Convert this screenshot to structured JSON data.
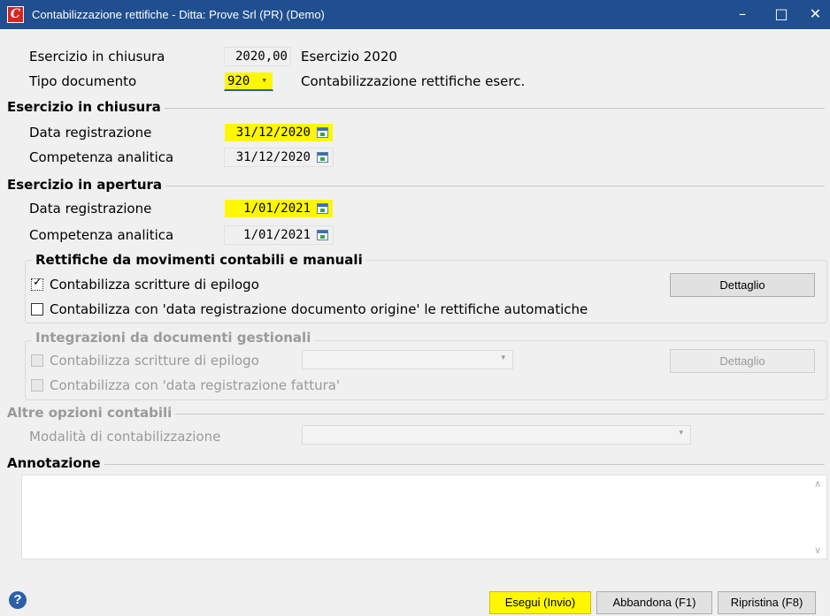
{
  "window": {
    "title": "Contabilizzazione rettifiche - Ditta: Prove Srl (PR)  (Demo)",
    "minimize": "–",
    "maximize": "□",
    "close": "✕"
  },
  "header": {
    "esercizio_label": "Esercizio in chiusura",
    "esercizio_value": "2020,00",
    "esercizio_desc": "Esercizio 2020",
    "tipo_label": "Tipo documento",
    "tipo_value": "920",
    "tipo_arrow": "▾",
    "tipo_desc": "Contabilizzazione rettifiche eserc."
  },
  "chiusura": {
    "title": "Esercizio in chiusura",
    "data_reg_label": "Data registrazione",
    "data_reg_value": "31/12/2020",
    "comp_label": "Competenza analitica",
    "comp_value": "31/12/2020"
  },
  "apertura": {
    "title": "Esercizio in apertura",
    "data_reg_label": "Data registrazione",
    "data_reg_value": "1/01/2021",
    "comp_label": "Competenza analitica",
    "comp_value": "1/01/2021"
  },
  "rettifiche": {
    "title": "Rettifiche da movimenti contabili e manuali",
    "cb1_label": "Contabilizza scritture di epilogo",
    "cb1_checked": true,
    "cb1_mark": "✓",
    "cb2_label": "Contabilizza con 'data registrazione documento origine' le rettifiche automatiche",
    "cb2_checked": false,
    "dettaglio_label": "Dettaglio"
  },
  "integrazioni": {
    "title": "Integrazioni da documenti gestionali",
    "cb1_label": "Contabilizza scritture di epilogo",
    "combo_arrow": "▾",
    "cb2_label": "Contabilizza con 'data registrazione fattura'",
    "dettaglio_label": "Dettaglio"
  },
  "altre": {
    "title": "Altre opzioni contabili",
    "modalita_label": "Modalità di contabilizzazione",
    "combo_arrow": "▾"
  },
  "annotazione": {
    "title": "Annotazione",
    "scroll_up": "∧",
    "scroll_down": "∨"
  },
  "footer": {
    "help": "?",
    "esegui": "Esegui (Invio)",
    "abbandona": "Abbandona (F1)",
    "ripristina": "Ripristina (F8)"
  },
  "colors": {
    "titlebar": "#1f4f8f",
    "highlight": "#fff700",
    "background": "#f0f0f0"
  }
}
